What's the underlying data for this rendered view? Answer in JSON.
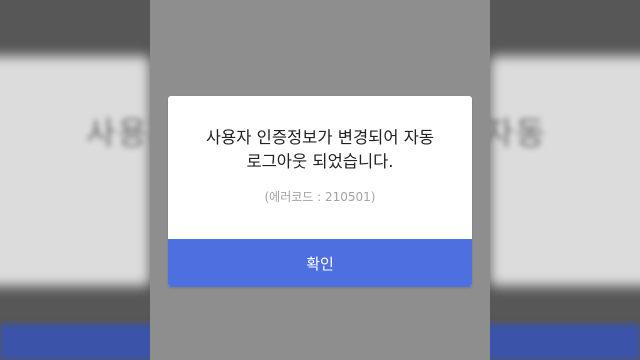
{
  "background": {
    "blurred_text": "사용자 인증"
  },
  "dialog": {
    "message_line1": "사용자 인증정보가 변경되어 자동",
    "message_line2": "로그아웃 되었습니다.",
    "error_code": "(에러코드 : 210501)",
    "confirm_label": "확인"
  },
  "colors": {
    "accent": "#4d6fdf",
    "overlay": "#8e8e8e",
    "dialog_bg": "#ffffff",
    "muted_text": "#a3a3a3"
  }
}
